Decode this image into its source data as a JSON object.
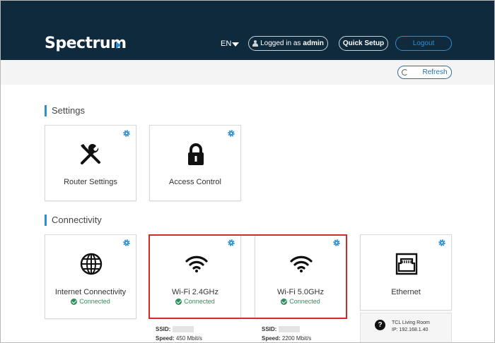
{
  "header": {
    "brand": "Spectrum",
    "language": "EN",
    "logged_in_prefix": "Logged in as",
    "username": "admin",
    "quick_setup_label": "Quick Setup",
    "logout_label": "Logout"
  },
  "toolbar": {
    "refresh_label": "Refresh"
  },
  "settings": {
    "title": "Settings",
    "cards": [
      {
        "label": "Router Settings",
        "icon": "tools-icon"
      },
      {
        "label": "Access Control",
        "icon": "lock-icon"
      }
    ]
  },
  "connectivity": {
    "title": "Connectivity",
    "cards": [
      {
        "label": "Internet Connectivity",
        "status": "Connected",
        "icon": "globe-icon"
      },
      {
        "label": "Wi-Fi 2.4GHz",
        "status": "Connected",
        "icon": "wifi-icon",
        "ssid_label": "SSID:",
        "speed_label": "Speed:",
        "speed_value": "450 Mbit/s"
      },
      {
        "label": "Wi-Fi 5.0GHz",
        "status": "Connected",
        "icon": "wifi-icon",
        "ssid_label": "SSID:",
        "speed_label": "Speed:",
        "speed_value": "2200 Mbit/s"
      },
      {
        "label": "Ethernet",
        "icon": "ethernet-port-icon"
      }
    ],
    "ethernet_device": {
      "name": "TCL Living Room",
      "ip": "IP: 192.168.1.40"
    }
  },
  "colors": {
    "header_bg": "#0e2a3c",
    "accent": "#2b8fd6",
    "connected": "#2f8f5b",
    "highlight": "#d12b2b"
  }
}
